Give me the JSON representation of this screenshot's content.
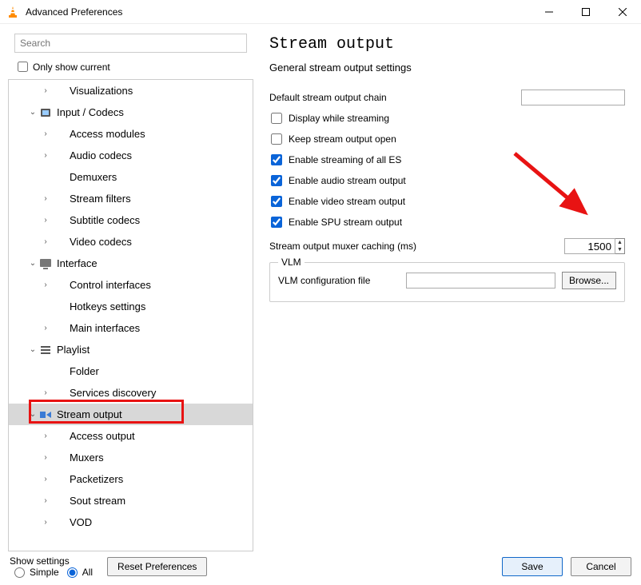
{
  "window": {
    "title": "Advanced Preferences"
  },
  "search": {
    "placeholder": "Search"
  },
  "only_show_current": "Only show current",
  "tree": {
    "items": [
      {
        "label": "Visualizations",
        "depth": 2,
        "exp": "›",
        "icon": ""
      },
      {
        "label": "Input / Codecs",
        "depth": 1,
        "exp": "⌄",
        "icon": "codec"
      },
      {
        "label": "Access modules",
        "depth": 2,
        "exp": "›",
        "icon": ""
      },
      {
        "label": "Audio codecs",
        "depth": 2,
        "exp": "›",
        "icon": ""
      },
      {
        "label": "Demuxers",
        "depth": 2,
        "exp": "",
        "icon": ""
      },
      {
        "label": "Stream filters",
        "depth": 2,
        "exp": "›",
        "icon": ""
      },
      {
        "label": "Subtitle codecs",
        "depth": 2,
        "exp": "›",
        "icon": ""
      },
      {
        "label": "Video codecs",
        "depth": 2,
        "exp": "›",
        "icon": ""
      },
      {
        "label": "Interface",
        "depth": 1,
        "exp": "⌄",
        "icon": "interface"
      },
      {
        "label": "Control interfaces",
        "depth": 2,
        "exp": "›",
        "icon": ""
      },
      {
        "label": "Hotkeys settings",
        "depth": 2,
        "exp": "",
        "icon": ""
      },
      {
        "label": "Main interfaces",
        "depth": 2,
        "exp": "›",
        "icon": ""
      },
      {
        "label": "Playlist",
        "depth": 1,
        "exp": "⌄",
        "icon": "playlist"
      },
      {
        "label": "Folder",
        "depth": 2,
        "exp": "",
        "icon": ""
      },
      {
        "label": "Services discovery",
        "depth": 2,
        "exp": "›",
        "icon": ""
      },
      {
        "label": "Stream output",
        "depth": 1,
        "exp": "⌄",
        "icon": "sout",
        "selected": true
      },
      {
        "label": "Access output",
        "depth": 2,
        "exp": "›",
        "icon": ""
      },
      {
        "label": "Muxers",
        "depth": 2,
        "exp": "›",
        "icon": ""
      },
      {
        "label": "Packetizers",
        "depth": 2,
        "exp": "›",
        "icon": ""
      },
      {
        "label": "Sout stream",
        "depth": 2,
        "exp": "›",
        "icon": ""
      },
      {
        "label": "VOD",
        "depth": 2,
        "exp": "›",
        "icon": ""
      }
    ]
  },
  "panel": {
    "heading": "Stream output",
    "subhead": "General stream output settings",
    "labels": {
      "chain": "Default stream output chain",
      "display": "Display while streaming",
      "keep": "Keep stream output open",
      "all_es": "Enable streaming of all ES",
      "audio": "Enable audio stream output",
      "video": "Enable video stream output",
      "spu": "Enable SPU stream output",
      "mux": "Stream output muxer caching (ms)",
      "vlm_legend": "VLM",
      "vlm_conf": "VLM configuration file",
      "browse": "Browse..."
    },
    "values": {
      "chain": "",
      "display": false,
      "keep": false,
      "all_es": true,
      "audio": true,
      "video": true,
      "spu": true,
      "mux": "1500",
      "vlm_conf": ""
    }
  },
  "footer": {
    "show_settings": "Show settings",
    "simple": "Simple",
    "all": "All",
    "reset": "Reset Preferences",
    "save": "Save",
    "cancel": "Cancel"
  }
}
